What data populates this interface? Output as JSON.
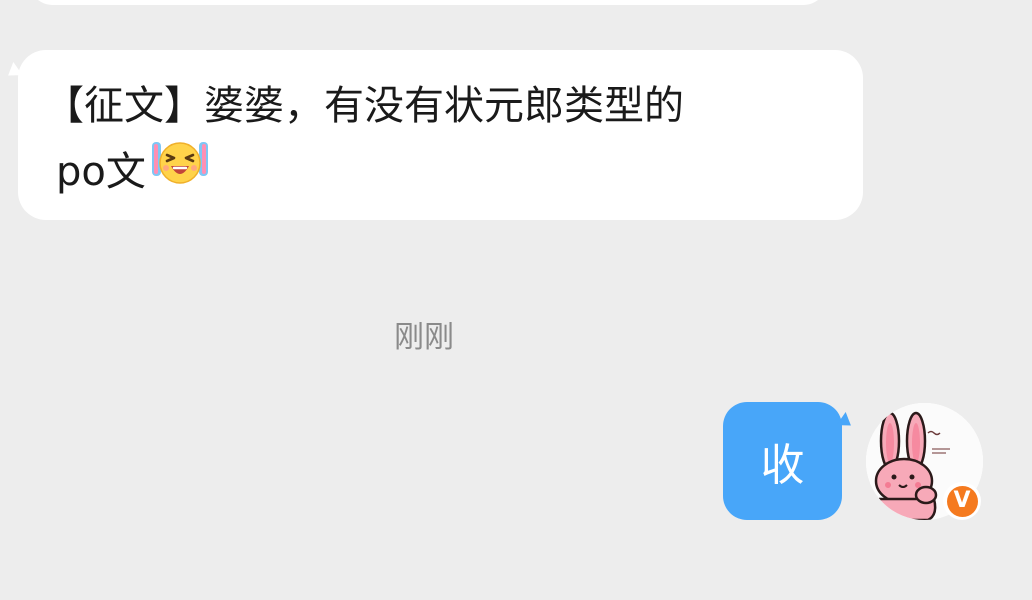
{
  "chat": {
    "incoming": {
      "line1": "【征文】婆婆，有没有状元郎类型的",
      "line2": "po文",
      "emoji": "laughing-tears-emoji"
    },
    "timestamp": "刚刚",
    "outgoing": {
      "text": "收"
    },
    "avatar": {
      "icon": "pink-bunny-avatar",
      "badge_letter": "V",
      "badge_color": "#f57a1f"
    }
  },
  "colors": {
    "background": "#ededed",
    "incoming_bubble": "#ffffff",
    "outgoing_bubble": "#48a6f9",
    "timestamp": "#8a8a8a"
  }
}
